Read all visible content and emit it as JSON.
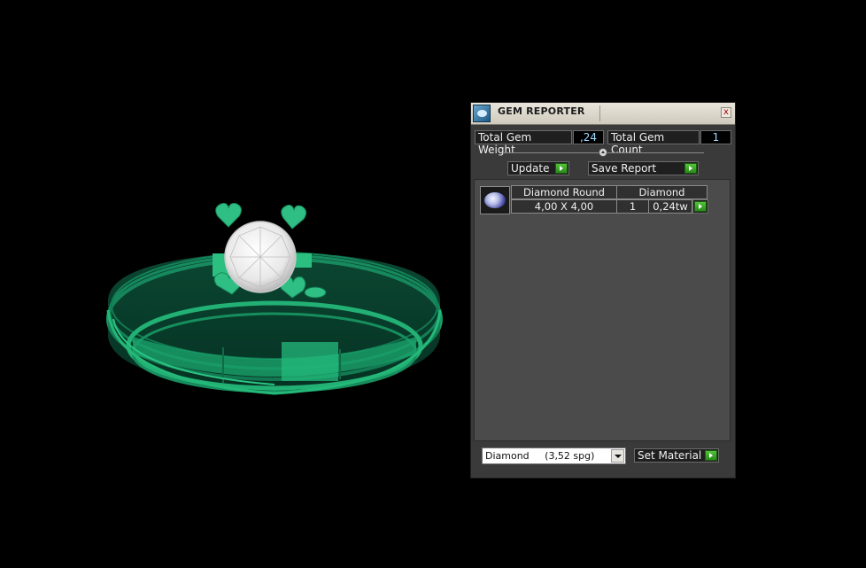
{
  "panel": {
    "title": "GEM REPORTER",
    "close_label": "x",
    "total_weight_label": "Total Gem Weight",
    "total_weight_value": ",24",
    "total_count_label": "Total Gem Count",
    "total_count_value": "1",
    "update_label": "Update",
    "save_report_label": "Save Report"
  },
  "gems": [
    {
      "shape": "Diamond Round",
      "material": "Diamond",
      "size": "4,00 X 4,00",
      "count": "1",
      "weight": "0,24tw"
    }
  ],
  "material_select": {
    "selected": "Diamond     (3,52 spg)"
  },
  "set_material_label": "Set Material",
  "colors": {
    "ring_green": "#1fa06d",
    "panel_bg": "#3a3a3a",
    "accent_green": "#2a8a1a"
  },
  "icons": [
    "gem-reporter-icon",
    "close-icon",
    "slider-knob",
    "play-arrow-icon",
    "gem-thumbnail",
    "dropdown-arrow-icon"
  ]
}
